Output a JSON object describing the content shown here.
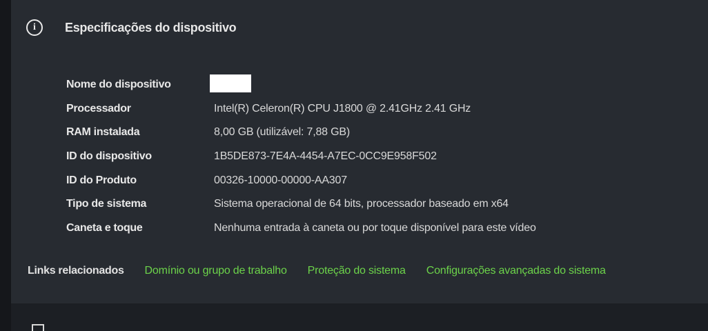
{
  "header": {
    "title": "Especificações do dispositivo",
    "icon": "info-icon"
  },
  "specs": [
    {
      "label": "Nome do dispositivo",
      "value": ""
    },
    {
      "label": "Processador",
      "value": "Intel(R) Celeron(R) CPU  J1800  @ 2.41GHz   2.41 GHz"
    },
    {
      "label": "RAM instalada",
      "value": "8,00 GB (utilizável: 7,88 GB)"
    },
    {
      "label": "ID do dispositivo",
      "value": "1B5DE873-7E4A-4454-A7EC-0CC9E958F502"
    },
    {
      "label": "ID do Produto",
      "value": "00326-10000-00000-AA307"
    },
    {
      "label": "Tipo de sistema",
      "value": "Sistema operacional de 64 bits, processador baseado em x64"
    },
    {
      "label": "Caneta e toque",
      "value": "Nenhuma entrada à caneta ou por toque disponível para este vídeo"
    }
  ],
  "related": {
    "label": "Links relacionados",
    "links": [
      "Domínio ou grupo de trabalho",
      "Proteção do sistema",
      "Configurações avançadas do sistema"
    ]
  },
  "colors": {
    "link": "#6cd34a",
    "text": "#e6e6e6",
    "background": "#272b31"
  }
}
